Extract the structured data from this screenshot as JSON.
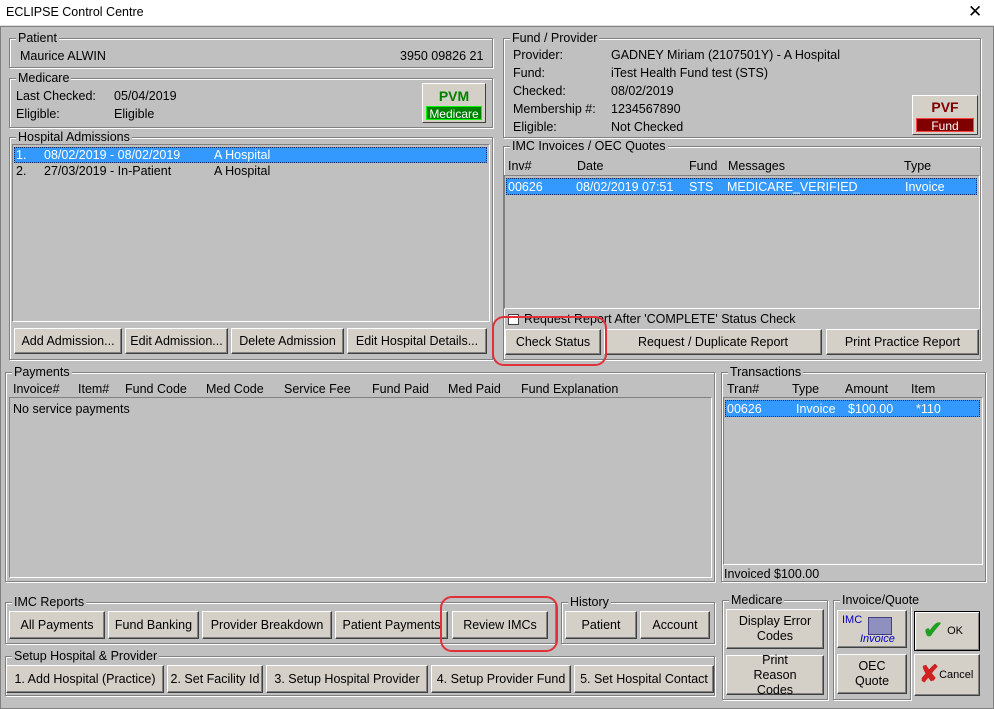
{
  "window": {
    "title": "ECLIPSE Control Centre",
    "close_glyph": "✕"
  },
  "patient": {
    "legend": "Patient",
    "name": "Maurice ALWIN",
    "number": "3950 09826 21"
  },
  "medicare": {
    "legend": "Medicare",
    "last_checked_label": "Last Checked:",
    "last_checked": "05/04/2019",
    "eligible_label": "Eligible:",
    "eligible": "Eligible",
    "badge_top": "PVM",
    "badge_bottom": "Medicare",
    "badge_color": "#008000"
  },
  "hospital": {
    "legend": "Hospital Admissions",
    "rows": [
      {
        "num": "1.",
        "dates": "08/02/2019 - 08/02/2019",
        "place": "A Hospital"
      },
      {
        "num": "2.",
        "dates": "27/03/2019 - In-Patient",
        "place": "A Hospital"
      }
    ],
    "buttons": {
      "add": "Add Admission...",
      "edit": "Edit Admission...",
      "delete": "Delete Admission",
      "edit_hospital": "Edit Hospital Details..."
    }
  },
  "fund": {
    "legend": "Fund / Provider",
    "provider_label": "Provider:",
    "provider": "GADNEY Miriam (2107501Y) - A Hospital",
    "fund_label": "Fund:",
    "fund": "iTest Health Fund test  (STS)",
    "checked_label": "Checked:",
    "checked": "08/02/2019",
    "membership_label": "Membership #:",
    "membership": "1234567890",
    "eligible_label": "Eligible:",
    "eligible": "Not Checked",
    "badge_top": "PVF",
    "badge_bottom": "Fund",
    "badge_color": "#800000"
  },
  "imc": {
    "legend": "IMC Invoices / OEC Quotes",
    "headers": [
      "Inv#",
      "Date",
      "Fund",
      "Messages",
      "Type"
    ],
    "rows": [
      {
        "inv": "00626",
        "date": "08/02/2019 07:51",
        "fund": "STS",
        "message": "MEDICARE_VERIFIED",
        "type": "Invoice"
      }
    ],
    "request_report_label": "Request Report After 'COMPLETE' Status Check",
    "check_status": "Check Status",
    "request_duplicate": "Request / Duplicate Report",
    "print_practice": "Print Practice Report"
  },
  "payments": {
    "legend": "Payments",
    "headers": [
      "Invoice#",
      "Item#",
      "Fund Code",
      "Med Code",
      "Service Fee",
      "Fund Paid",
      "Med Paid",
      "Fund Explanation"
    ],
    "empty": "No service payments"
  },
  "transactions": {
    "legend": "Transactions",
    "headers": [
      "Tran#",
      "Type",
      "Amount",
      "Item"
    ],
    "rows": [
      {
        "tran": "00626",
        "type": "Invoice",
        "amount": "$100.00",
        "item": "*110"
      }
    ],
    "invoiced": "Invoiced $100.00"
  },
  "imc_reports": {
    "legend": "IMC Reports",
    "all_payments": "All Payments",
    "fund_banking": "Fund Banking",
    "provider_breakdown": "Provider Breakdown",
    "patient_payments": "Patient Payments",
    "review_imcs": "Review IMCs"
  },
  "history": {
    "legend": "History",
    "patient": "Patient",
    "account": "Account"
  },
  "setup": {
    "legend": "Setup Hospital & Provider",
    "add_hospital": "1. Add Hospital (Practice)",
    "set_facility": "2. Set Facility Id",
    "set_provider": "3. Setup Hospital Provider",
    "setup_fund": "4. Setup Provider Fund",
    "set_contact": "5. Set Hospital Contact"
  },
  "medicare_bottom": {
    "legend": "Medicare",
    "display_error": "Display Error Codes",
    "print_reason": "Print Reason Codes"
  },
  "invoice_quote": {
    "legend": "Invoice/Quote",
    "imc_label": "IMC",
    "invoice_label": "Invoice",
    "oec_quote": "OEC Quote"
  },
  "actions": {
    "ok": "OK",
    "cancel": "Cancel"
  },
  "colors": {
    "highlight": "#3399ff",
    "annotation": "#e0303a"
  }
}
